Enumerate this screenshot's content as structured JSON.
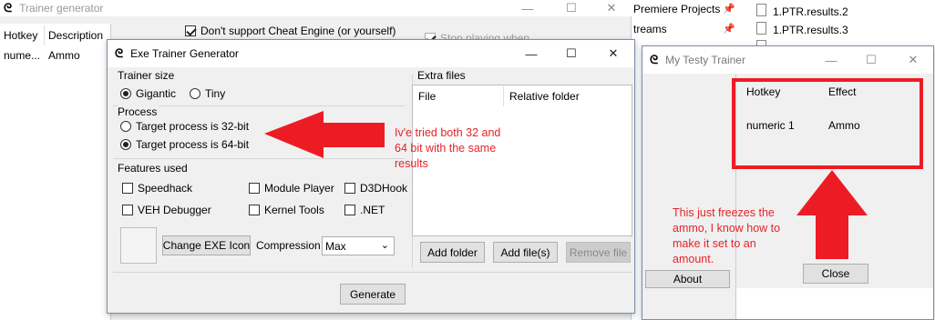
{
  "colors": {
    "accent_red": "#ed1c24",
    "note_red": "#e8222a"
  },
  "bg_window": {
    "title": "Trainer generator",
    "columns": [
      "Hotkey",
      "Description"
    ],
    "row": [
      "nume...",
      "Ammo"
    ],
    "dont_support": "Don't support Cheat Engine (or yourself)",
    "stop_playing": "Stop playing when"
  },
  "explorer": {
    "items": [
      "Premiere Projects",
      "treams",
      "1.PTR.results.2",
      "1.PTR.results.3"
    ]
  },
  "exe_generator": {
    "title": "Exe Trainer Generator",
    "trainer_size": {
      "label": "Trainer size",
      "options": [
        "Gigantic",
        "Tiny"
      ]
    },
    "process": {
      "label": "Process",
      "options": [
        "Target process is 32-bit",
        "Target process is 64-bit"
      ]
    },
    "features": {
      "label": "Features used",
      "items": [
        "Speedhack",
        "Module Player",
        "D3DHook",
        "VEH Debugger",
        "Kernel Tools",
        ".NET"
      ]
    },
    "change_icon": "Change EXE Icon",
    "compression_label": "Compression",
    "compression_value": "Max",
    "extra_files": {
      "label": "Extra files",
      "columns": [
        "File",
        "Relative folder"
      ]
    },
    "add_folder": "Add folder",
    "add_files": "Add file(s)",
    "remove_file": "Remove file",
    "generate": "Generate"
  },
  "testy": {
    "title": "My Testy Trainer",
    "headers": [
      "Hotkey",
      "Effect"
    ],
    "row": [
      "numeric 1",
      "Ammo"
    ],
    "about": "About",
    "close": "Close"
  },
  "annotations": {
    "note1": [
      "Iv'e tried both 32 and",
      "64 bit with the same",
      "results"
    ],
    "note2": [
      "This just freezes the",
      "ammo, I know how to",
      "make it set to an",
      "amount."
    ]
  }
}
